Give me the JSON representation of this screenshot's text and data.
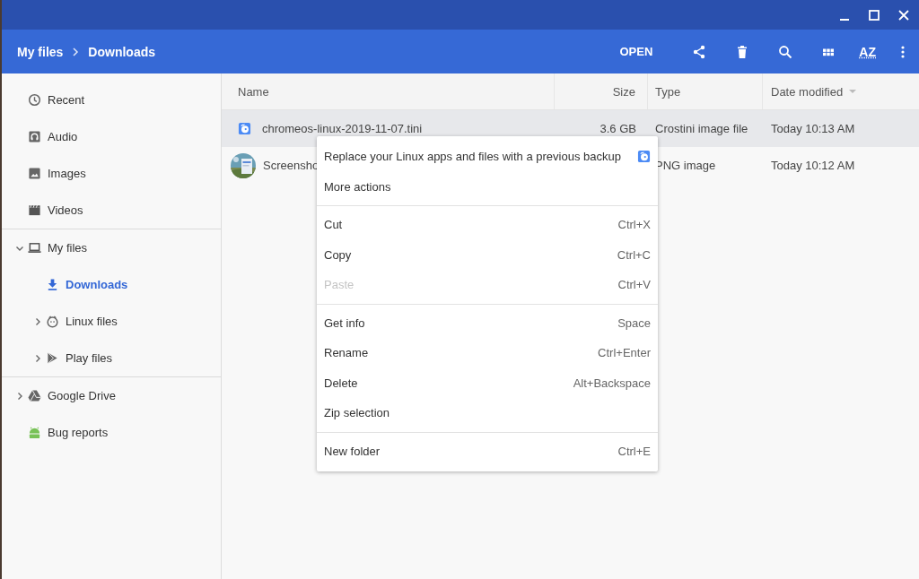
{
  "breadcrumb": [
    "My files",
    "Downloads"
  ],
  "toolbar": {
    "open_label": "OPEN",
    "sort_label": "AZ"
  },
  "sidebar": {
    "sections": [
      {
        "items": [
          {
            "label": "Recent",
            "selected": false
          },
          {
            "label": "Audio",
            "selected": false
          },
          {
            "label": "Images",
            "selected": false
          },
          {
            "label": "Videos",
            "selected": false
          }
        ]
      },
      {
        "items": [
          {
            "label": "My files",
            "selected": false,
            "expanded": true,
            "children": [
              {
                "label": "Downloads",
                "selected": true
              },
              {
                "label": "Linux files",
                "selected": false,
                "expanded": false
              },
              {
                "label": "Play files",
                "selected": false,
                "expanded": false
              }
            ]
          }
        ]
      },
      {
        "items": [
          {
            "label": "Google Drive",
            "selected": false,
            "expanded": false
          },
          {
            "label": "Bug reports",
            "selected": false
          }
        ]
      }
    ]
  },
  "table": {
    "columns": [
      {
        "label": "Name",
        "sorted": false
      },
      {
        "label": "Size",
        "sorted": false
      },
      {
        "label": "Type",
        "sorted": false
      },
      {
        "label": "Date modified",
        "sorted": true
      }
    ],
    "rows": [
      {
        "name": "chromeos-linux-2019-11-07.tini",
        "size": "3.6 GB",
        "type": "Crostini image file",
        "date": "Today 10:13 AM",
        "selected": true,
        "kind": "crostini"
      },
      {
        "name": "Screensho",
        "type": "PNG image",
        "date": "Today 10:12 AM",
        "selected": false,
        "kind": "picture"
      }
    ]
  },
  "context_menu": {
    "groups": [
      [
        {
          "label": "Replace your Linux apps and files with a previous backup",
          "disabled": false,
          "app_icon": true
        },
        {
          "label": "More actions",
          "disabled": false
        }
      ],
      [
        {
          "label": "Cut",
          "shortcut": "Ctrl+X",
          "disabled": false
        },
        {
          "label": "Copy",
          "shortcut": "Ctrl+C",
          "disabled": false
        },
        {
          "label": "Paste",
          "shortcut": "Ctrl+V",
          "disabled": true
        }
      ],
      [
        {
          "label": "Get info",
          "shortcut": "Space",
          "disabled": false
        },
        {
          "label": "Rename",
          "shortcut": "Ctrl+Enter",
          "disabled": false
        },
        {
          "label": "Delete",
          "shortcut": "Alt+Backspace",
          "disabled": false
        },
        {
          "label": "Zip selection",
          "disabled": false
        }
      ],
      [
        {
          "label": "New folder",
          "shortcut": "Ctrl+E",
          "disabled": false
        }
      ]
    ]
  }
}
